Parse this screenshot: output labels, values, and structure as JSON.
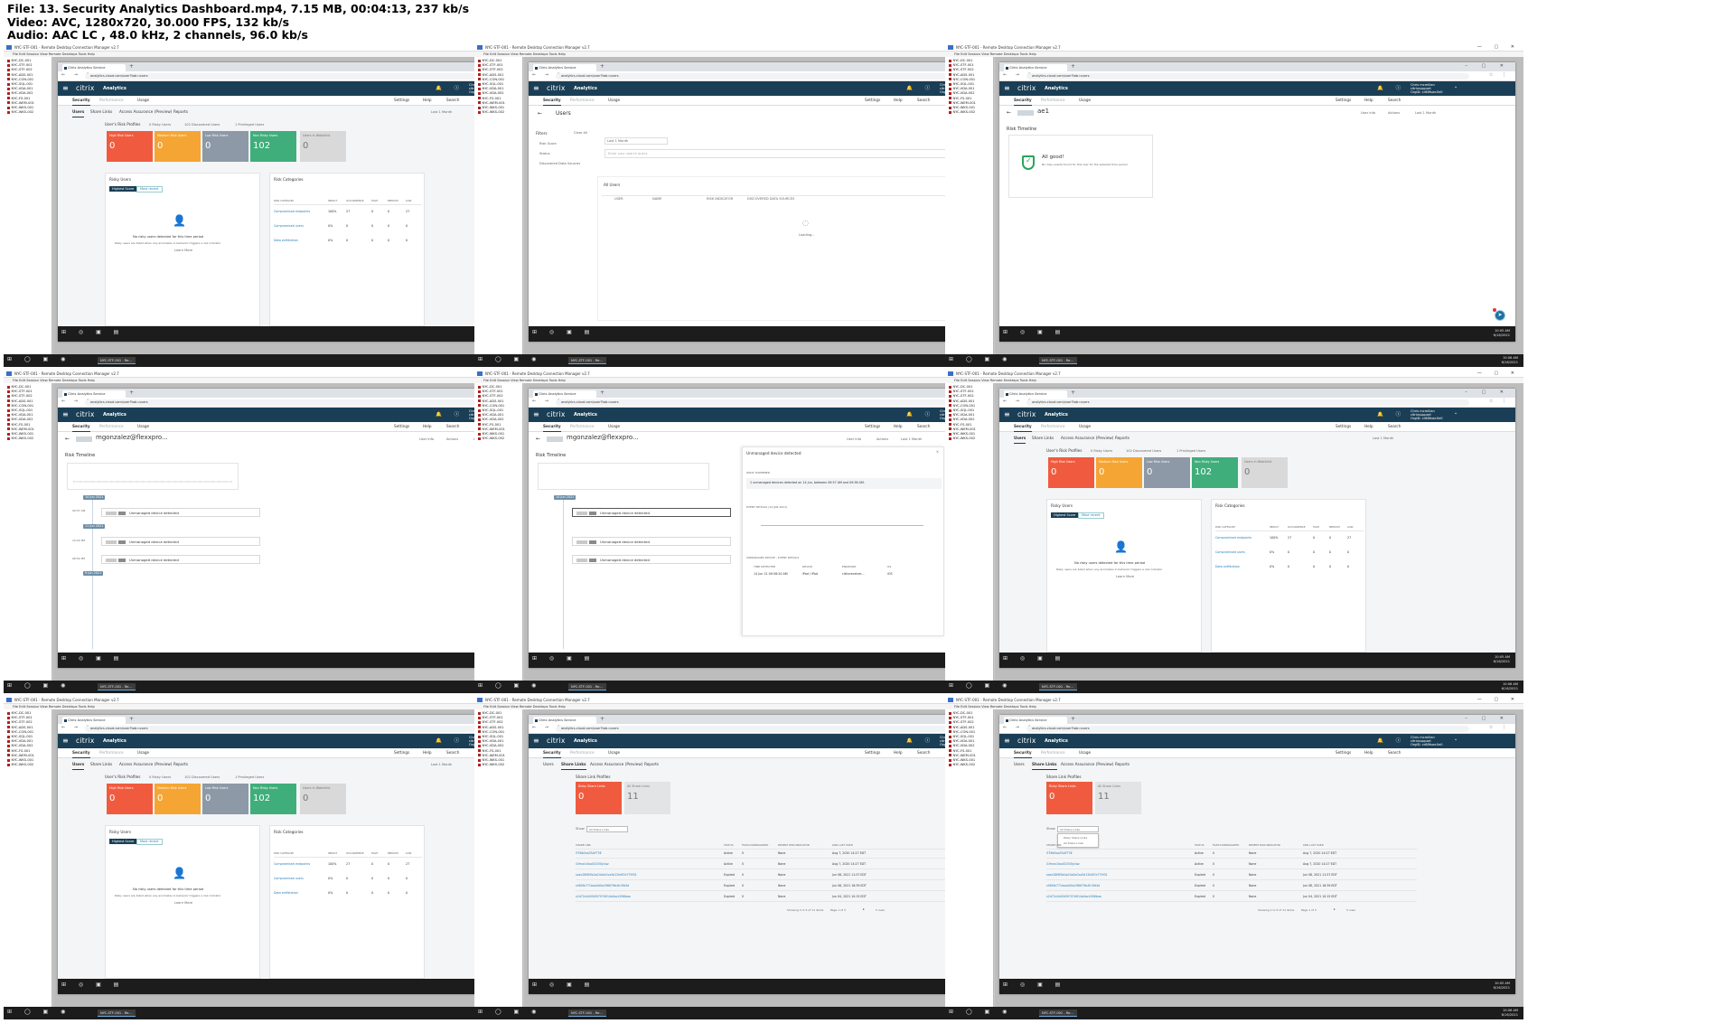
{
  "header": {
    "file_line": "File: 13. Security Analytics Dashboard.mp4, 7.15 MB, 00:04:13, 237 kb/s",
    "video_line": "Video: AVC, 1280x720, 30.000 FPS, 132 kb/s",
    "audio_line": "Audio: AAC LC , 48.0 kHz, 2 channels, 96.0 kb/s"
  },
  "common": {
    "rdc_title": "NYC-STF-001 - Remote Desktop Connection Manager v2.7",
    "rdc_menu": "File   Edit   Session   View   Remote Desktops   Tools   Help",
    "tree_items": [
      "NYC-DC-001",
      "NYC-STF-001",
      "NYC-STF-002",
      "NYC-ADS-001",
      "NYC-CON-001",
      "NYC-SQL-001",
      "NYC-VDA-001",
      "NYC-VDA-002",
      "NYC-FS-001",
      "NYC-WEM-001",
      "NYC-WKS-001",
      "NYC-WKS-002"
    ],
    "tab_title": "Citrix Analytics Service",
    "url_base": "analytics.cloud.com/user?tab=users",
    "brand": "citrix",
    "product": "Analytics",
    "user_name": "Chris mcmillan",
    "user_sub1": "citrixsupport",
    "user_sub2": "OrgID: cr68fswc0e0",
    "nav_security": "Security",
    "nav_performance": "Performance",
    "nav_usage": "Usage",
    "nav_settings": "Settings",
    "nav_help": "Help",
    "nav_search": "Search",
    "tab_users": "Users",
    "tab_share_links": "Share Links",
    "tab_access_assurance": "Access Assurance (Preview)",
    "tab_reports": "Reports",
    "last_month": "Last 1 Month",
    "time_inner": "10:05 AM\n6/16/2021",
    "time_host": "10:06 AM\n6/16/2021",
    "host_task": "NYC-STF-001 - Re..."
  },
  "risk": {
    "title": "User's Risk Profiles",
    "risky_link": "0 Risky Users",
    "discovered_link": "102 Discovered Users",
    "privileged_link": "1 Privileged Users",
    "cards": [
      {
        "label": "High Risk Users",
        "value": "0",
        "color": "#f05b3f"
      },
      {
        "label": "Medium Risk Users",
        "value": "0",
        "color": "#f5a533"
      },
      {
        "label": "Low Risk Users",
        "value": "0",
        "color": "#8d99a6"
      },
      {
        "label": "Non Risky Users",
        "value": "102",
        "color": "#3fae7b"
      },
      {
        "label": "Users in Watchlist",
        "value": "0",
        "color": "#d9d9d9"
      }
    ],
    "riskyusers_title": "Risky Users",
    "btn_highest": "Highest Score",
    "btn_recent": "Most recent",
    "no_risky_main": "No risky users detected for this time period",
    "no_risky_sub": "Risky users are listed when any anomalies in behavior triggers a risk indicator",
    "learn_more": "Learn More",
    "categories_title": "Risk Categories",
    "cat_headers": [
      "RISK CATEGORY",
      "IMPACT",
      "OCCURRENCE",
      "HIGH",
      "MEDIUM",
      "LOW"
    ],
    "cat_rows": [
      {
        "name": "Compromised endpoints",
        "impact": "100%",
        "occ": "27",
        "high": "0",
        "med": "0",
        "low": "27"
      },
      {
        "name": "Compromised users",
        "impact": "0%",
        "occ": "0",
        "high": "0",
        "med": "0",
        "low": "0"
      },
      {
        "name": "Data exfiltration",
        "impact": "0%",
        "occ": "0",
        "high": "0",
        "med": "0",
        "low": "0"
      }
    ]
  },
  "users_search": {
    "title": "Users",
    "filters": "Filters",
    "clear_all": "Clear All",
    "filter_items": [
      "Risk Score",
      "Status",
      "Discovered Data Sources"
    ],
    "time_select": "Last 1 Month",
    "search_placeholder": "Enter your search query",
    "search_btn": "Search",
    "all_users": "All Users",
    "add_watch": "Add to Watchlist Users",
    "col_heads": [
      "USER",
      "NAME",
      "RISK INDICATOR",
      "DISCOVERED DATA SOURCES"
    ],
    "loading": "Loading..."
  },
  "ae1": {
    "user_label": "ae1",
    "user_info": "User Info",
    "actions": "Actions",
    "risk_timeline": "Risk Timeline",
    "all_good": "All good!",
    "all_good_sub": "No risky events found for this user for the selected time period"
  },
  "mgonz": {
    "user_label": "mgonzalez@flexxpro...",
    "user_label_full": "mgonzalez@flexxpro...",
    "risk_timeline": "Risk Timeline",
    "dates": [
      "14 Jun 2021",
      "11 Jun 2021",
      "9 Jun 2021"
    ],
    "events": [
      "Unmanaged device detected",
      "Unmanaged device detected",
      "Unmanaged device detected"
    ],
    "times": [
      "09:57 AM",
      "10:22 PM",
      "08:52 PM"
    ],
    "detail_title": "Unmanaged device detected",
    "what_happened": "WHAT HAPPENED",
    "what_text": "1 unmanaged devices detected on 14 Jun, between 09:57 AM and 09:58 AM.",
    "event_details": "EVENT DETAILS (14 JUN 2021)",
    "device_details": "UNMANAGED DEVICE - EVENT DETAILS",
    "dd_heads": [
      "TIME DETECTED",
      "DEVICE",
      "ENDPOINT",
      "OS"
    ],
    "dd_row": [
      "14 Jun 21 09:58:20 AM",
      "iPad / iPad",
      "citrixreceiver...",
      "iOS"
    ]
  },
  "share": {
    "title": "Share Link Profiles",
    "risky_label": "Risky Share Links",
    "risky_value": "0",
    "all_label": "All Share Links",
    "all_value": "11",
    "filter_label": "Show",
    "filter_value": "All Share Links",
    "dd_opt1": "Risky Share Links",
    "dd_opt2": "All Share Links",
    "heads": [
      "SHARE LINK",
      "STATUS",
      "FILES DOWNLOADED",
      "RECENT RISK INDICATOR",
      "LINK LAST USED"
    ],
    "rows": [
      {
        "link": "iTE6b5oaTAAFT5E",
        "status": "Active",
        "files": "0",
        "risk": "None",
        "last": "Aug 7, 2020 14:27 EDT"
      },
      {
        "link": "i1fmav1koo52030yLwz",
        "status": "Active",
        "files": "0",
        "risk": "None",
        "last": "Aug 7, 2020 14:27 EDT"
      },
      {
        "link": "saec28f6f0b4a24d4c0ca3d12fe87e779f31",
        "status": "Expired",
        "files": "0",
        "risk": "None",
        "last": "Jun 08, 2021 11:57 EDT"
      },
      {
        "link": "s960fe771baa0d0a298679b4fc3fd4d",
        "status": "Expired",
        "files": "0",
        "risk": "None",
        "last": "Jun 08, 2021 16:39 EDT"
      },
      {
        "link": "s2d72c0d004f0707d914a0ac4096baa",
        "status": "Expired",
        "files": "0",
        "risk": "None",
        "last": "Jun 04, 2021 10:15 EDT"
      }
    ],
    "pager": "Showing 1 to 5 of 11 items",
    "page": "Page 1 of 3",
    "rows_sel": "5 rows"
  }
}
